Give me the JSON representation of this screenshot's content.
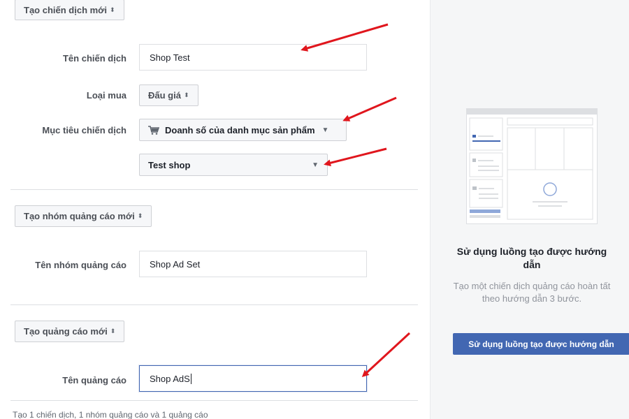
{
  "campaign": {
    "section_button": "Tạo chiến dịch mới",
    "name_label": "Tên chiến dịch",
    "name_value": "Shop Test",
    "buy_type_label": "Loại mua",
    "buy_type_value": "Đấu giá",
    "objective_label": "Mục tiêu chiến dịch",
    "objective_value": "Doanh số của danh mục sản phẩm",
    "catalog_value": "Test shop"
  },
  "adset": {
    "section_button": "Tạo nhóm quảng cáo mới",
    "name_label": "Tên nhóm quảng cáo",
    "name_value": "Shop Ad Set"
  },
  "ad": {
    "section_button": "Tạo quảng cáo mới",
    "name_label": "Tên quảng cáo",
    "name_value": "Shop AdS"
  },
  "footer": {
    "summary": "Tạo 1 chiến dịch, 1 nhóm quảng cáo và 1 quảng cáo"
  },
  "side_panel": {
    "title": "Sử dụng luồng tạo được hướng dẫn",
    "description": "Tạo một chiến dịch quảng cáo hoàn tất theo hướng dẫn 3 bước.",
    "button_label": "Sử dụng luồng tạo được hướng dẫn"
  },
  "icons": {
    "updown": "updown-arrows-icon",
    "cart": "shopping-cart-icon",
    "dropdown": "triangle-down-icon"
  },
  "colors": {
    "accent": "#4267b2",
    "annotation": "#e0161d",
    "panel_bg": "#f5f6f7"
  }
}
